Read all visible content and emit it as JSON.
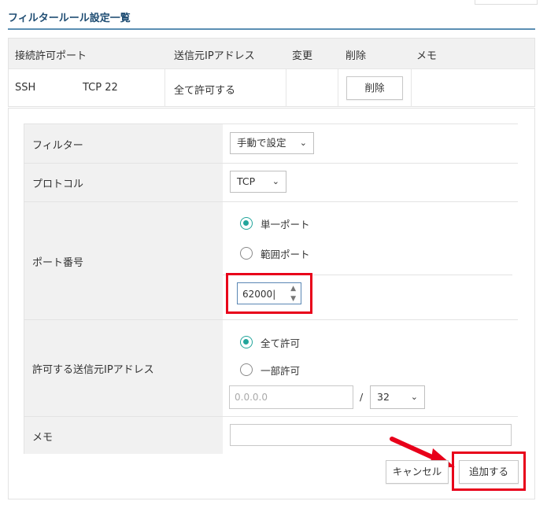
{
  "page": {
    "title": "フィルタールール設定一覧"
  },
  "table": {
    "headers": [
      "接続許可ポート",
      "送信元IPアドレス",
      "変更",
      "削除",
      "メモ"
    ],
    "row": {
      "service": "SSH",
      "port": "TCP 22",
      "source": "全て許可する",
      "delete_label": "削除",
      "memo": ""
    }
  },
  "form": {
    "filter": {
      "label": "フィルター",
      "value": "手動で設定"
    },
    "protocol": {
      "label": "プロトコル",
      "value": "TCP"
    },
    "port": {
      "label": "ポート番号",
      "options": [
        {
          "label": "単一ポート",
          "selected": true
        },
        {
          "label": "範囲ポート",
          "selected": false
        }
      ],
      "value": "62000"
    },
    "source_ip": {
      "label": "許可する送信元IPアドレス",
      "options": [
        {
          "label": "全て許可",
          "selected": true
        },
        {
          "label": "一部許可",
          "selected": false
        }
      ],
      "ip_placeholder": "0.0.0.0",
      "separator": "/",
      "mask_value": "32"
    },
    "memo": {
      "label": "メモ",
      "value": ""
    }
  },
  "actions": {
    "cancel_label": "キャンセル",
    "add_label": "追加する"
  },
  "colors": {
    "accent": "#22a59b",
    "highlight": "#e8001a",
    "title": "#1f4d73"
  }
}
